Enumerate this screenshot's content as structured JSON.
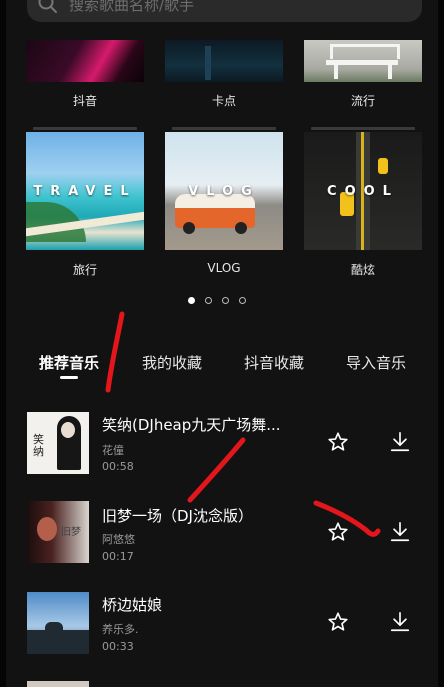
{
  "search": {
    "placeholder": "搜索歌曲名称/歌手"
  },
  "categories_top": [
    {
      "label": "抖音"
    },
    {
      "label": "卡点"
    },
    {
      "label": "流行"
    }
  ],
  "categories_mid": [
    {
      "label": "旅行",
      "overlay": "TRAVEL"
    },
    {
      "label": "VLOG",
      "overlay": "VLOG"
    },
    {
      "label": "酷炫",
      "overlay": "COOL"
    }
  ],
  "pager": {
    "total": 4,
    "active": 1
  },
  "tabs": [
    {
      "label": "推荐音乐",
      "active": true
    },
    {
      "label": "我的收藏",
      "active": false
    },
    {
      "label": "抖音收藏",
      "active": false
    },
    {
      "label": "导入音乐",
      "active": false
    }
  ],
  "songs": [
    {
      "title": "笑纳(DJheap九天广场舞...",
      "artist": "花僮",
      "duration": "00:58"
    },
    {
      "title": "旧梦一场（DJ沈念版）",
      "artist": "阿悠悠",
      "duration": "00:17"
    },
    {
      "title": "桥边姑娘",
      "artist": "养乐多.",
      "duration": "00:33"
    }
  ],
  "icons": {
    "search": "search-icon",
    "favorite": "star-outline-icon",
    "download": "download-icon"
  },
  "colors": {
    "background": "#121212",
    "annotation": "#e3161b"
  }
}
